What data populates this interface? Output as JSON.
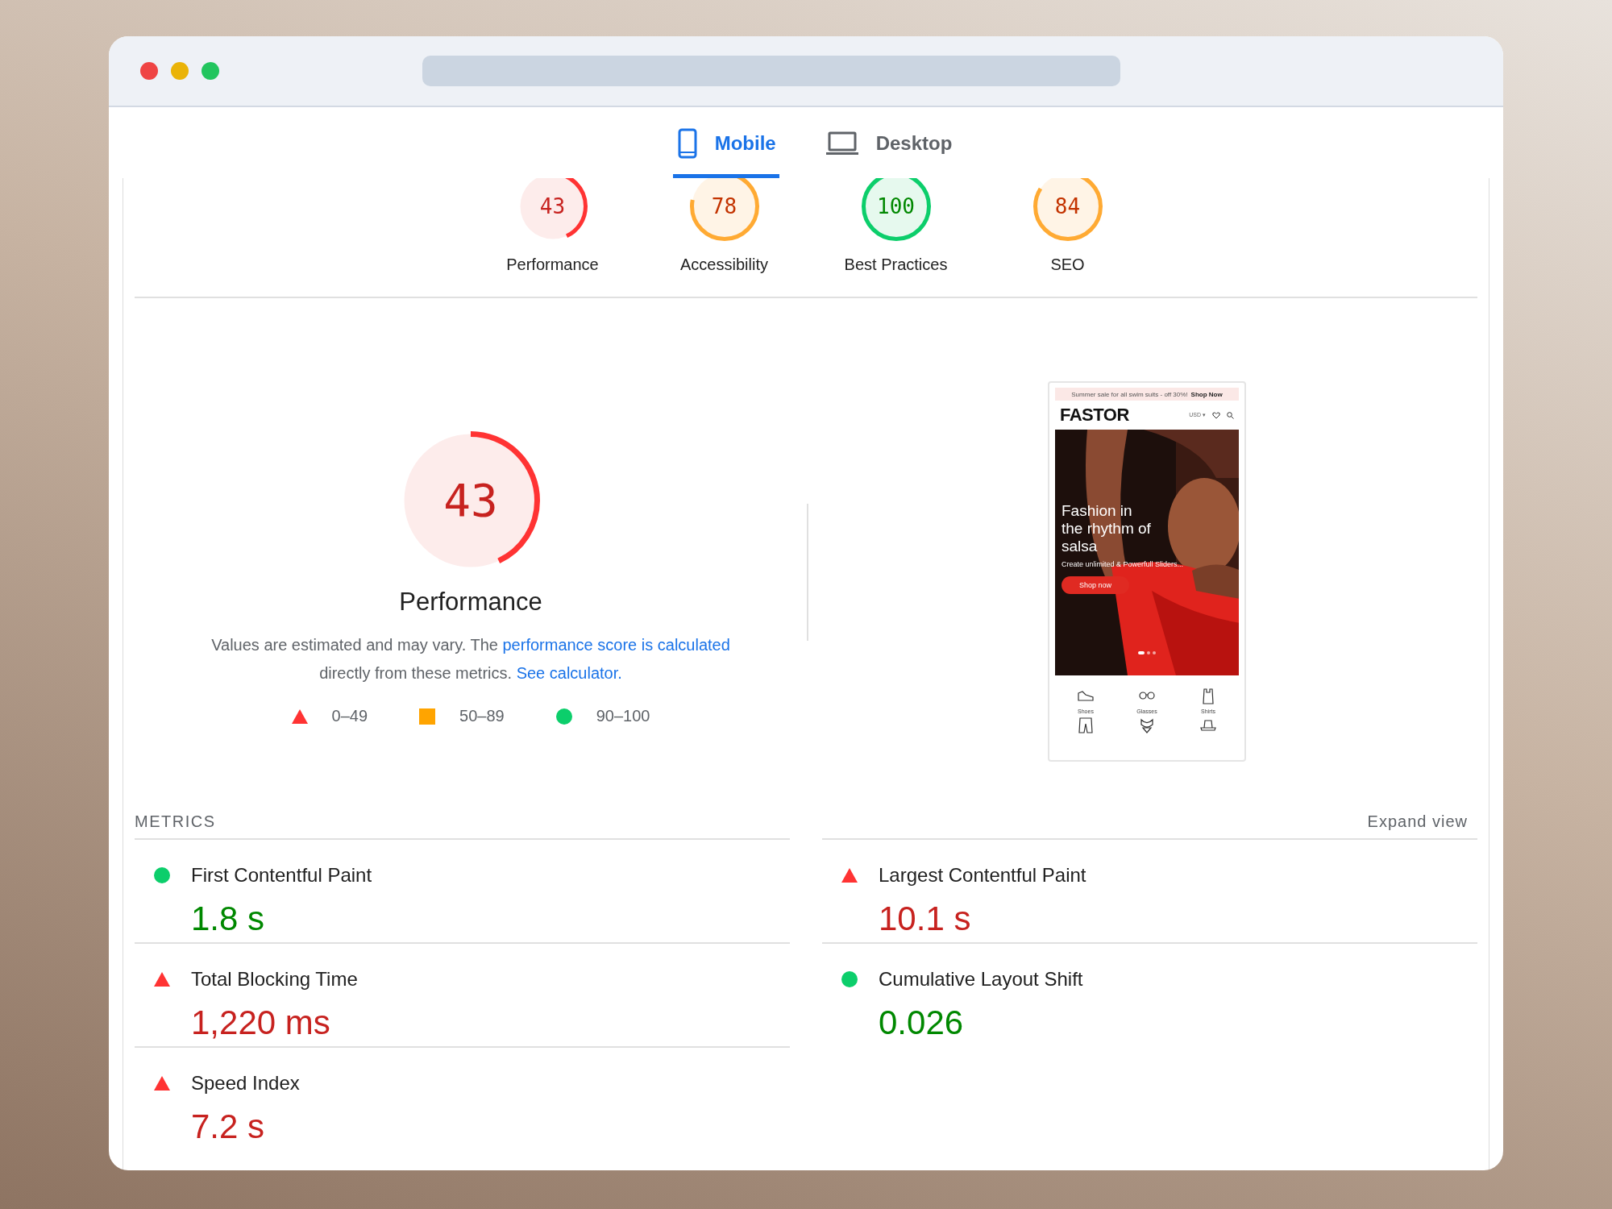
{
  "tabs": [
    {
      "label": "Mobile",
      "kind": "phone",
      "selected": true
    },
    {
      "label": "Desktop",
      "kind": "laptop",
      "selected": false
    }
  ],
  "gauges": [
    {
      "score": "43",
      "label": "Performance",
      "kind": "fail"
    },
    {
      "score": "78",
      "label": "Accessibility",
      "kind": "average"
    },
    {
      "score": "100",
      "label": "Best Practices",
      "kind": "pass"
    },
    {
      "score": "84",
      "label": "SEO",
      "kind": "average"
    }
  ],
  "performance": {
    "score": "43",
    "kind": "fail",
    "title": "Performance",
    "note_text": "Values are estimated and may vary. The ",
    "note_link": "performance score is calculated",
    "note_text_2": "directly from these metrics. ",
    "note_link_2": "See calculator.",
    "legend": [
      {
        "kind": "fail",
        "range": "0–49"
      },
      {
        "kind": "average",
        "range": "50–89"
      },
      {
        "kind": "pass",
        "range": "90–100"
      }
    ]
  },
  "screenshot": {
    "banner": "Summer sale for all swim suits - off 30%!",
    "banner_link": "Shop Now",
    "logo": "FASTOR",
    "currency": "USD ▾",
    "headline": "Fashion in the rhythm of salsa",
    "subline": "Create unlimited & Powerfull Sliders...",
    "cta": "Shop now",
    "slides": [
      {
        "selected": true
      },
      {
        "selected": false
      },
      {
        "selected": false
      }
    ],
    "categories": [
      {
        "label": "Shoes",
        "kind": "shoe"
      },
      {
        "label": "Glasses",
        "kind": "glasses"
      },
      {
        "label": "Shirts",
        "kind": "shirt"
      },
      {
        "kind": "shorts"
      },
      {
        "kind": "swimsuit"
      },
      {
        "kind": "hat"
      }
    ]
  },
  "metrics_title": "METRICS",
  "expand_label": "Expand view",
  "metrics": [
    {
      "name": "First Contentful Paint",
      "value": "1.8 s",
      "kind": "pass"
    },
    {
      "name": "Largest Contentful Paint",
      "value": "10.1 s",
      "kind": "fail"
    },
    {
      "name": "Total Blocking Time",
      "value": "1,220 ms",
      "kind": "fail"
    },
    {
      "name": "Cumulative Layout Shift",
      "value": "0.026",
      "kind": "pass"
    },
    {
      "name": "Speed Index",
      "value": "7.2 s",
      "kind": "fail"
    }
  ]
}
